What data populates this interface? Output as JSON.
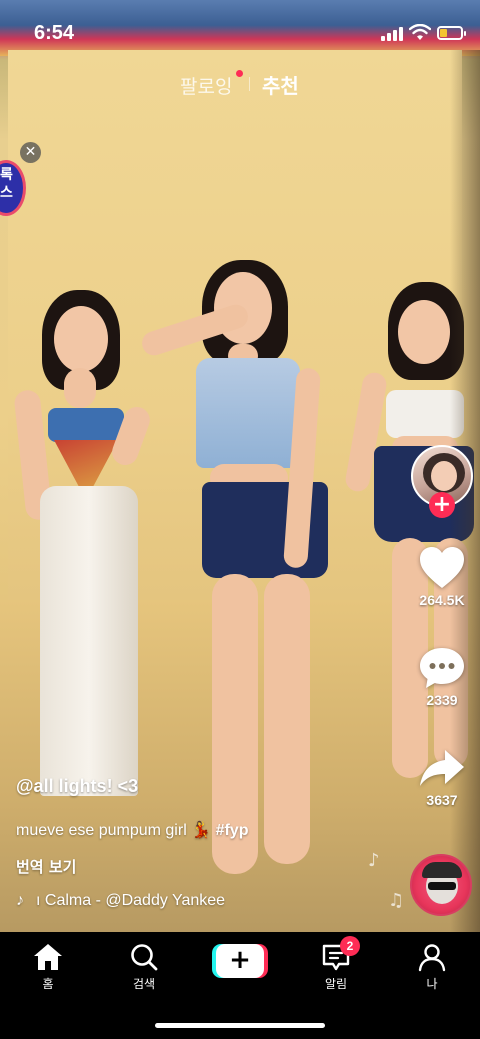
{
  "status_bar": {
    "time": "6:54",
    "battery_level": 0.35,
    "battery_color": "#f4c430"
  },
  "top_tabs": {
    "following": "팔로잉",
    "recommended": "추천",
    "following_has_new": true,
    "accent_color": "#fe2c55"
  },
  "live_widget": {
    "text_line1": "록",
    "text_line2": "스",
    "close_icon": "close-icon"
  },
  "actions": {
    "follow_icon": "plus-icon",
    "like_count": "264.5K",
    "comment_count": "2339",
    "share_count": "3637"
  },
  "caption": {
    "username": "@all lights! <3",
    "description": "mueve ese pumpum girl 💃",
    "hashtag": "#fyp",
    "translate_label": "번역 보기",
    "music": "ı Calma - @Daddy Yankee"
  },
  "bottom_nav": {
    "items": [
      {
        "label": "홈",
        "icon": "home-icon"
      },
      {
        "label": "검색",
        "icon": "search-icon"
      },
      {
        "label": "",
        "icon": "create-plus-icon"
      },
      {
        "label": "알림",
        "icon": "inbox-icon",
        "badge": "2"
      },
      {
        "label": "나",
        "icon": "profile-icon"
      }
    ]
  }
}
